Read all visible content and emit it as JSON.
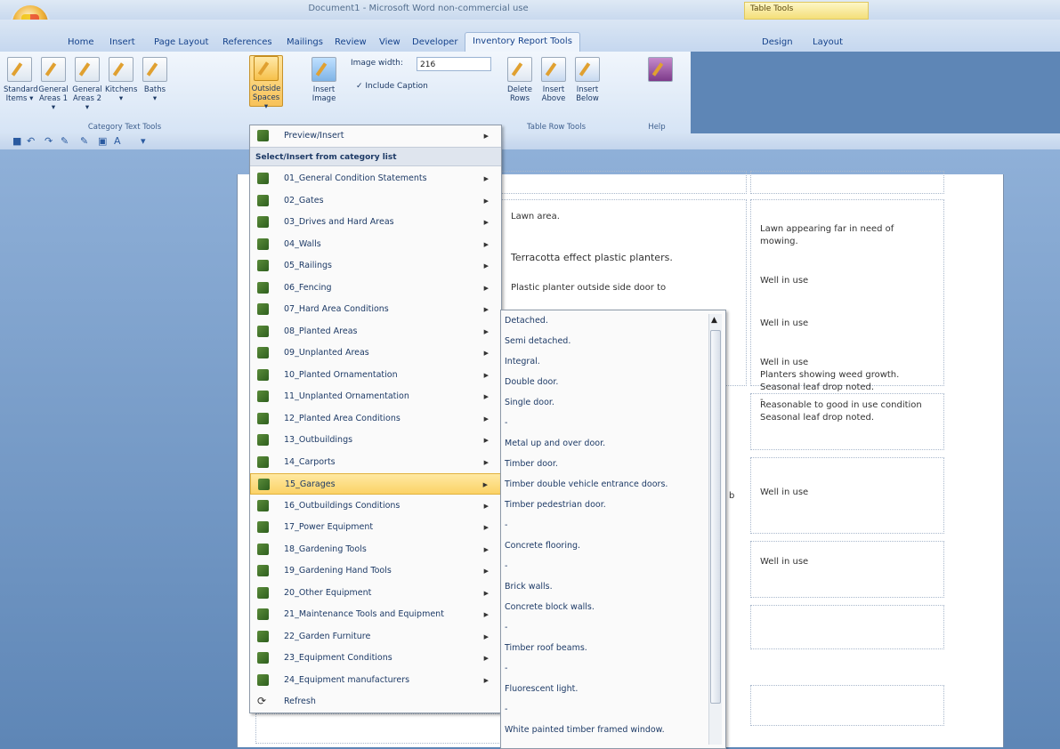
{
  "window": {
    "title": "Document1 - Microsoft Word non-commercial use",
    "context_tab": "Table Tools"
  },
  "tabs": [
    "Home",
    "Insert",
    "Page Layout",
    "References",
    "Mailings",
    "Review",
    "View",
    "Developer",
    "Inventory Report Tools",
    "Design",
    "Layout"
  ],
  "ribbon": {
    "buttons": [
      {
        "line1": "Standard",
        "line2": "Items ▾"
      },
      {
        "line1": "General",
        "line2": "Areas 1 ▾"
      },
      {
        "line1": "General",
        "line2": "Areas 2 ▾"
      },
      {
        "line1": "Kitchens",
        "line2": "▾"
      },
      {
        "line1": "Baths",
        "line2": "▾"
      },
      {
        "line1": "Outside",
        "line2": "Spaces ▾"
      }
    ],
    "insert_image": {
      "line1": "Insert",
      "line2": "Image"
    },
    "image_width_label": "Image width:",
    "image_width_value": "216",
    "include_caption": "✓ Include Caption",
    "row_tools": [
      {
        "line1": "Delete",
        "line2": "Rows"
      },
      {
        "line1": "Insert",
        "line2": "Above"
      },
      {
        "line1": "Insert",
        "line2": "Below"
      }
    ],
    "groups": {
      "category": "Category Text Tools",
      "row": "Table Row Tools",
      "help": "Help"
    }
  },
  "menu": {
    "preview_insert": "Preview/Insert",
    "header": "Select/Insert from category list",
    "items": [
      "01_General Condition Statements",
      "02_Gates",
      "03_Drives and Hard Areas",
      "04_Walls",
      "05_Railings",
      "06_Fencing",
      "07_Hard Area Conditions",
      "08_Planted Areas",
      "09_Unplanted Areas",
      "10_Planted Ornamentation",
      "11_Unplanted Ornamentation",
      "12_Planted Area Conditions",
      "13_Outbuildings",
      "14_Carports",
      "15_Garages",
      "16_Outbuildings Conditions",
      "17_Power Equipment",
      "18_Gardening Tools",
      "19_Gardening Hand Tools",
      "20_Other Equipment",
      "21_Maintenance Tools and Equipment",
      "22_Garden Furniture",
      "23_Equipment Conditions",
      "24_Equipment manufacturers"
    ],
    "refresh": "Refresh",
    "highlighted_index": 14
  },
  "submenu": {
    "items": [
      "Detached.",
      "Semi detached.",
      "Integral.",
      "Double door.",
      "Single door.",
      "-",
      "Metal up and over door.",
      "Timber door.",
      "Timber double vehicle entrance doors.",
      "Timber pedestrian door.",
      "-",
      "Concrete flooring.",
      "-",
      "Brick walls.",
      "Concrete block walls.",
      "-",
      "Timber roof beams.",
      "-",
      "Fluorescent light.",
      "-",
      "White painted timber framed window."
    ]
  },
  "document": {
    "left_col": [
      "Lawn area.",
      "Terracotta effect plastic planters.",
      "Plastic planter outside side door to"
    ],
    "right_col": [
      "Lawn appearing far in need of mowing.",
      "Well in use",
      "Well in use",
      "Well in use\nPlanters showing weed growth.\nSeasonal leaf drop noted.\n-",
      "Reasonable to good in use condition\nSeasonal leaf drop noted.",
      "Well in use",
      "Well in use"
    ],
    "cut_text": "b"
  }
}
